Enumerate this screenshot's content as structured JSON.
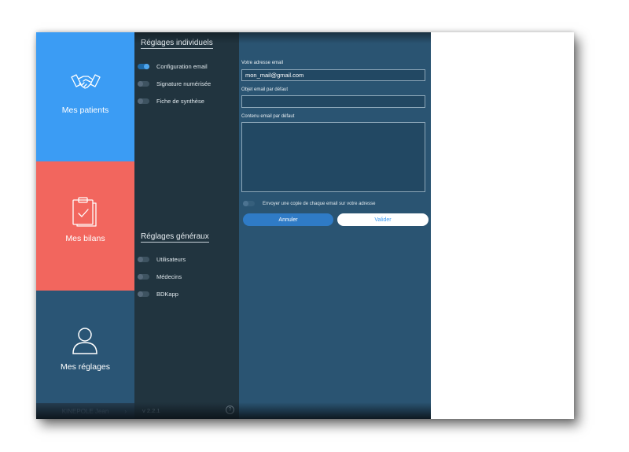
{
  "sidebar": {
    "tiles": [
      {
        "label": "Mes patients",
        "icon": "handshake-icon",
        "color": "#3b9cf4"
      },
      {
        "label": "Mes bilans",
        "icon": "clipboard-check-icon",
        "color": "#f2665e"
      },
      {
        "label": "Mes réglages",
        "icon": "user-icon",
        "color": "#2a5575"
      }
    ],
    "user_name": "KINEPOLE Jean",
    "user_arrow": "›"
  },
  "settings_nav": {
    "individual_title": "Réglages individuels",
    "individual_items": [
      {
        "label": "Configuration email",
        "active": true
      },
      {
        "label": "Signature numérisée",
        "active": false
      },
      {
        "label": "Fiche de synthèse",
        "active": false
      }
    ],
    "general_title": "Réglages généraux",
    "general_items": [
      {
        "label": "Utilisateurs",
        "active": false
      },
      {
        "label": "Médecins",
        "active": false
      },
      {
        "label": "BDKapp",
        "active": false
      }
    ],
    "version": "v 2.2.1",
    "help_icon": "help-icon",
    "help_glyph": "?"
  },
  "email_form": {
    "address_label": "Votre adresse email",
    "address_value": "mon_mail@gmail.com",
    "subject_label": "Objet email par défaut",
    "subject_value": "",
    "content_label": "Contenu email par défaut",
    "content_value": "",
    "copy_toggle_label": "Envoyer une copie de chaque email sur votre adresse",
    "copy_toggle_on": false,
    "cancel_label": "Annuler",
    "submit_label": "Valider"
  }
}
